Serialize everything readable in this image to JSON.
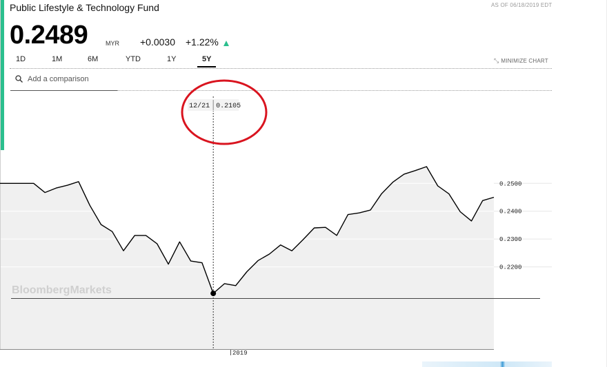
{
  "header": {
    "fund_name": "Public Lifestyle & Technology Fund",
    "as_of": "AS OF 06/18/2019 EDT",
    "price": "0.2489",
    "currency": "MYR",
    "change_abs": "+0.0030",
    "change_pct": "+1.22%",
    "change_direction_icon": "up-triangle-icon"
  },
  "colors": {
    "accent": "#2bbf8e",
    "line": "#000000",
    "fill": "#f0f0f0",
    "annotation": "#d9141f"
  },
  "range_tabs": [
    {
      "label": "1D",
      "active": false
    },
    {
      "label": "1M",
      "active": false
    },
    {
      "label": "6M",
      "active": false
    },
    {
      "label": "YTD",
      "active": false
    },
    {
      "label": "1Y",
      "active": false
    },
    {
      "label": "5Y",
      "active": true
    }
  ],
  "minimize_label": "MINIMIZE CHART",
  "minimize_icon": "minimize-arrows-icon",
  "search": {
    "placeholder": "Add a comparison",
    "icon": "search-icon"
  },
  "watermark": "BloombergMarkets",
  "tooltip": {
    "date": "12/21",
    "value": "0.2105"
  },
  "chart_data": {
    "type": "area",
    "xlabel": "",
    "ylabel": "",
    "x_tick_labels": [
      "2019"
    ],
    "y_ticks": [
      0.22,
      0.23,
      0.24,
      0.25
    ],
    "y_tick_labels": [
      "0.2200",
      "0.2300",
      "0.2400",
      "0.2500"
    ],
    "ylim": [
      0.1905,
      0.2775
    ],
    "grid": true,
    "highlighted_point": {
      "label": "12/21",
      "value": 0.2105
    },
    "series": [
      {
        "values": [
          0.25,
          0.25,
          0.25,
          0.25,
          0.2467,
          0.2483,
          0.2493,
          0.2506,
          0.2421,
          0.2352,
          0.2327,
          0.2258,
          0.2313,
          0.2313,
          0.2283,
          0.221,
          0.229,
          0.2221,
          0.2215,
          0.2105,
          0.214,
          0.2133,
          0.2183,
          0.2223,
          0.2246,
          0.2279,
          0.2258,
          0.2298,
          0.234,
          0.2342,
          0.2313,
          0.2388,
          0.2394,
          0.2404,
          0.2463,
          0.2504,
          0.2533,
          0.2546,
          0.256,
          0.2491,
          0.2462,
          0.2398,
          0.2365,
          0.2438,
          0.245
        ]
      }
    ]
  }
}
